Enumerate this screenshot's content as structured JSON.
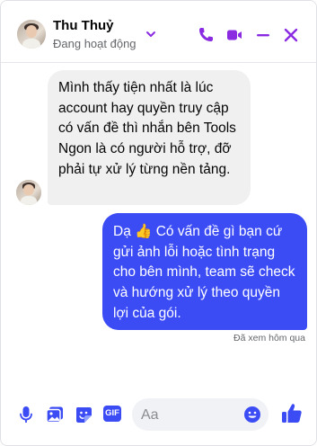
{
  "header": {
    "name": "Thu Thuỷ",
    "status": "Đang hoạt động",
    "icons": [
      "chevron-down-icon",
      "phone-icon",
      "video-icon",
      "minimize-icon",
      "close-icon"
    ]
  },
  "messages": [
    {
      "direction": "incoming",
      "text": "Mình thấy tiện nhất là lúc account hay quyền truy cập có vấn đề thì nhắn bên Tools Ngon là có người hỗ trợ, đỡ phải tự xử lý từng nền tảng."
    },
    {
      "direction": "outgoing",
      "text": "Dạ 👍 Có vấn đề gì bạn cứ gửi ảnh lỗi hoặc tình trạng cho bên mình, team sẽ check và hướng xử lý theo quyền lợi của gói."
    }
  ],
  "seen_label": "Đã xem hôm qua",
  "composer": {
    "placeholder": "Aa",
    "gif_label": "GIF",
    "icons": [
      "microphone-icon",
      "image-icon",
      "sticker-icon",
      "gif-icon",
      "emoji-icon",
      "thumbs-up-icon"
    ]
  },
  "colors": {
    "accent": "#3c4cf5",
    "incoming_bubble": "#f0f0f0",
    "header_icon": "#8a2be2"
  }
}
